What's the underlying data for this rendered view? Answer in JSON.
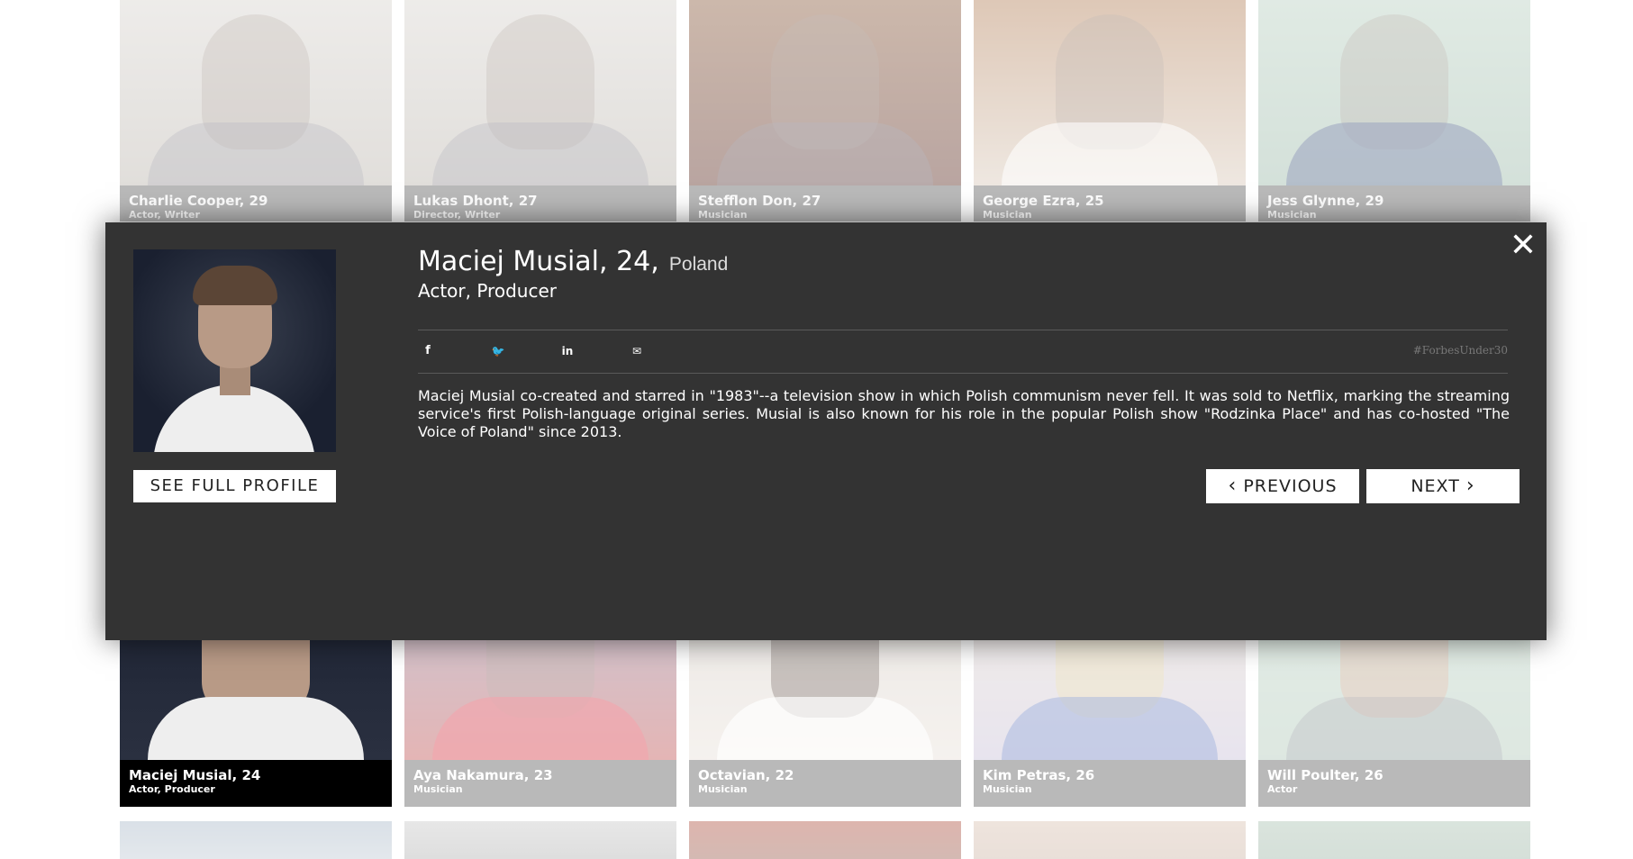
{
  "grid": {
    "row1": [
      {
        "name": "Charlie Cooper, 29",
        "role": "Actor, Writer"
      },
      {
        "name": "Lukas Dhont, 27",
        "role": "Director, Writer"
      },
      {
        "name": "Stefflon Don, 27",
        "role": "Musician"
      },
      {
        "name": "George Ezra, 25",
        "role": "Musician"
      },
      {
        "name": "Jess Glynne, 29",
        "role": "Musician"
      }
    ],
    "row2": [
      {
        "name": "Maciej Musial, 24",
        "role": "Actor, Producer"
      },
      {
        "name": "Aya Nakamura, 23",
        "role": "Musician"
      },
      {
        "name": "Octavian, 22",
        "role": "Musician"
      },
      {
        "name": "Kim Petras, 26",
        "role": "Musician"
      },
      {
        "name": "Will Poulter, 26",
        "role": "Actor"
      }
    ]
  },
  "modal": {
    "close_glyph": "✕",
    "name": "Maciej Musial, 24,",
    "country": "Poland",
    "role": "Actor, Producer",
    "see_full_profile": "SEE FULL PROFILE",
    "share": {
      "facebook_glyph": "f",
      "twitter_glyph": "🐦",
      "linkedin_glyph": "in",
      "email_glyph": "✉",
      "hashtag": "#ForbesUnder30"
    },
    "bio": "Maciej Musial co-created and starred in \"1983\"--a television show in which Polish communism never fell. It was sold to Netflix, marking the streaming service's first Polish-language original series. Musial is also known for his role in the popular Polish show \"Rodzinka Place\" and has co-hosted \"The Voice of Poland\" since 2013.",
    "previous_label": "PREVIOUS",
    "next_label": "NEXT",
    "prev_chevron": "‹",
    "next_chevron": "›"
  }
}
